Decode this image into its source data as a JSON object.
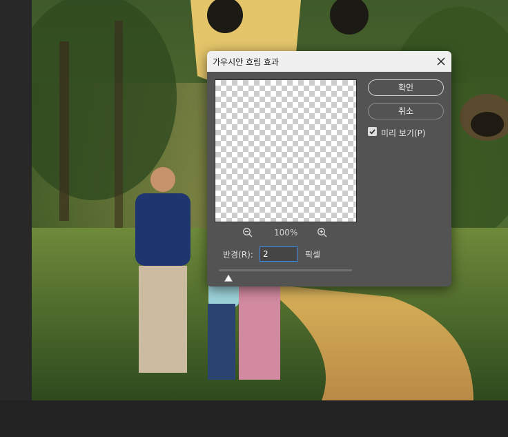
{
  "dialog": {
    "title": "가우시안 흐림 효과",
    "ok_label": "확인",
    "cancel_label": "취소",
    "preview_label": "미리 보기(P)",
    "preview_checked": true,
    "zoom": "100%",
    "radius_label": "반경(R):",
    "radius_value": "2",
    "unit_label": "픽셀",
    "slider_fraction": 0.07
  },
  "icons": {
    "close": "close-icon",
    "zoom_out": "zoom-out-icon",
    "zoom_in": "zoom-in-icon",
    "checkbox": "checkmark-icon"
  },
  "colors": {
    "dialog_bg": "#535353",
    "titlebar_bg": "#f0f0f0",
    "input_border": "#3b8cf0",
    "workspace_bg": "#282828"
  }
}
